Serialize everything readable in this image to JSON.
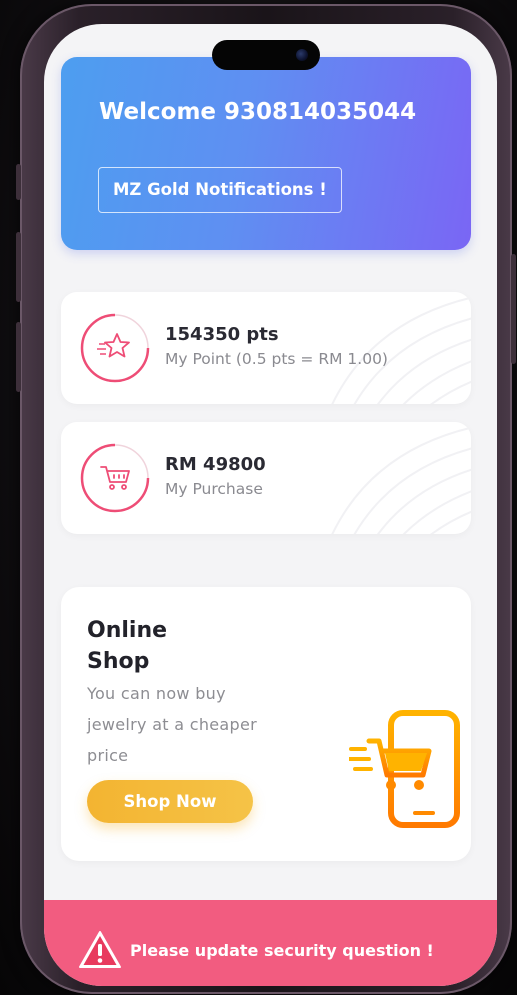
{
  "header": {
    "welcome_text": "Welcome 930814035044",
    "notifications_label": "MZ Gold Notifications !"
  },
  "stats": {
    "points": {
      "value": "154350 pts",
      "label": "My Point (0.5 pts = RM 1.00)",
      "icon": "star-icon"
    },
    "purchase": {
      "value": "RM 49800",
      "label": "My Purchase",
      "icon": "cart-icon"
    }
  },
  "shop": {
    "title": "Online Shop",
    "description": "You can now buy jewelry at a cheaper price",
    "button_label": "Shop Now",
    "illustration": "phone-cart-icon"
  },
  "alert": {
    "text": "Please update security question !",
    "icon": "warning-icon"
  },
  "colors": {
    "header_gradient_start": "#4d9ef0",
    "header_gradient_end": "#7a66f4",
    "accent_pink": "#ee4d76",
    "shop_button": "#f3b431",
    "alert_bar": "#f25c80"
  }
}
